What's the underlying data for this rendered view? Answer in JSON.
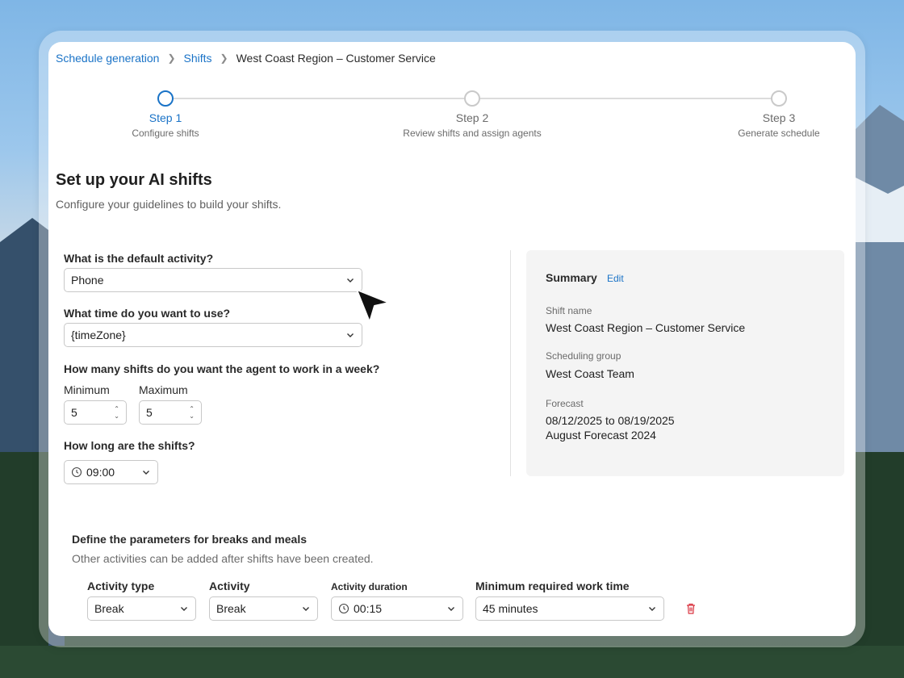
{
  "breadcrumb": {
    "items": [
      "Schedule generation",
      "Shifts"
    ],
    "current": "West Coast Region – Customer Service"
  },
  "stepper": {
    "steps": [
      {
        "title": "Step 1",
        "subtitle": "Configure shifts",
        "active": true
      },
      {
        "title": "Step 2",
        "subtitle": "Review shifts and assign agents",
        "active": false
      },
      {
        "title": "Step 3",
        "subtitle": "Generate schedule",
        "active": false
      }
    ]
  },
  "page": {
    "title": "Set up your AI shifts",
    "subtitle": "Configure your guidelines to build your shifts."
  },
  "form": {
    "default_activity": {
      "question": "What is the default activity?",
      "value": "Phone"
    },
    "time_zone": {
      "question": "What time do you want to use?",
      "value": "{timeZone}"
    },
    "shifts_per_week": {
      "question": "How many shifts do you want the agent to work in a week?",
      "min_label": "Minimum",
      "min_value": "5",
      "max_label": "Maximum",
      "max_value": "5"
    },
    "shift_length": {
      "question": "How long are the shifts?",
      "value": "09:00"
    }
  },
  "summary": {
    "heading": "Summary",
    "edit_label": "Edit",
    "shift_name_label": "Shift name",
    "shift_name": "West Coast Region – Customer Service",
    "group_label": "Scheduling group",
    "group": "West Coast Team",
    "forecast_label": "Forecast",
    "forecast_dates": "08/12/2025 to 08/19/2025",
    "forecast_name": "August Forecast 2024"
  },
  "breaks": {
    "title": "Define the parameters for breaks and meals",
    "subtitle": "Other activities can be added after shifts have been created.",
    "headers": {
      "activity_type": "Activity type",
      "activity": "Activity",
      "duration": "Activity duration",
      "min_work": "Minimum required work time"
    },
    "row": {
      "activity_type": "Break",
      "activity": "Break",
      "duration": "00:15",
      "min_work": "45 minutes"
    }
  },
  "colors": {
    "accent": "#1a73c7",
    "danger": "#d9333f"
  }
}
